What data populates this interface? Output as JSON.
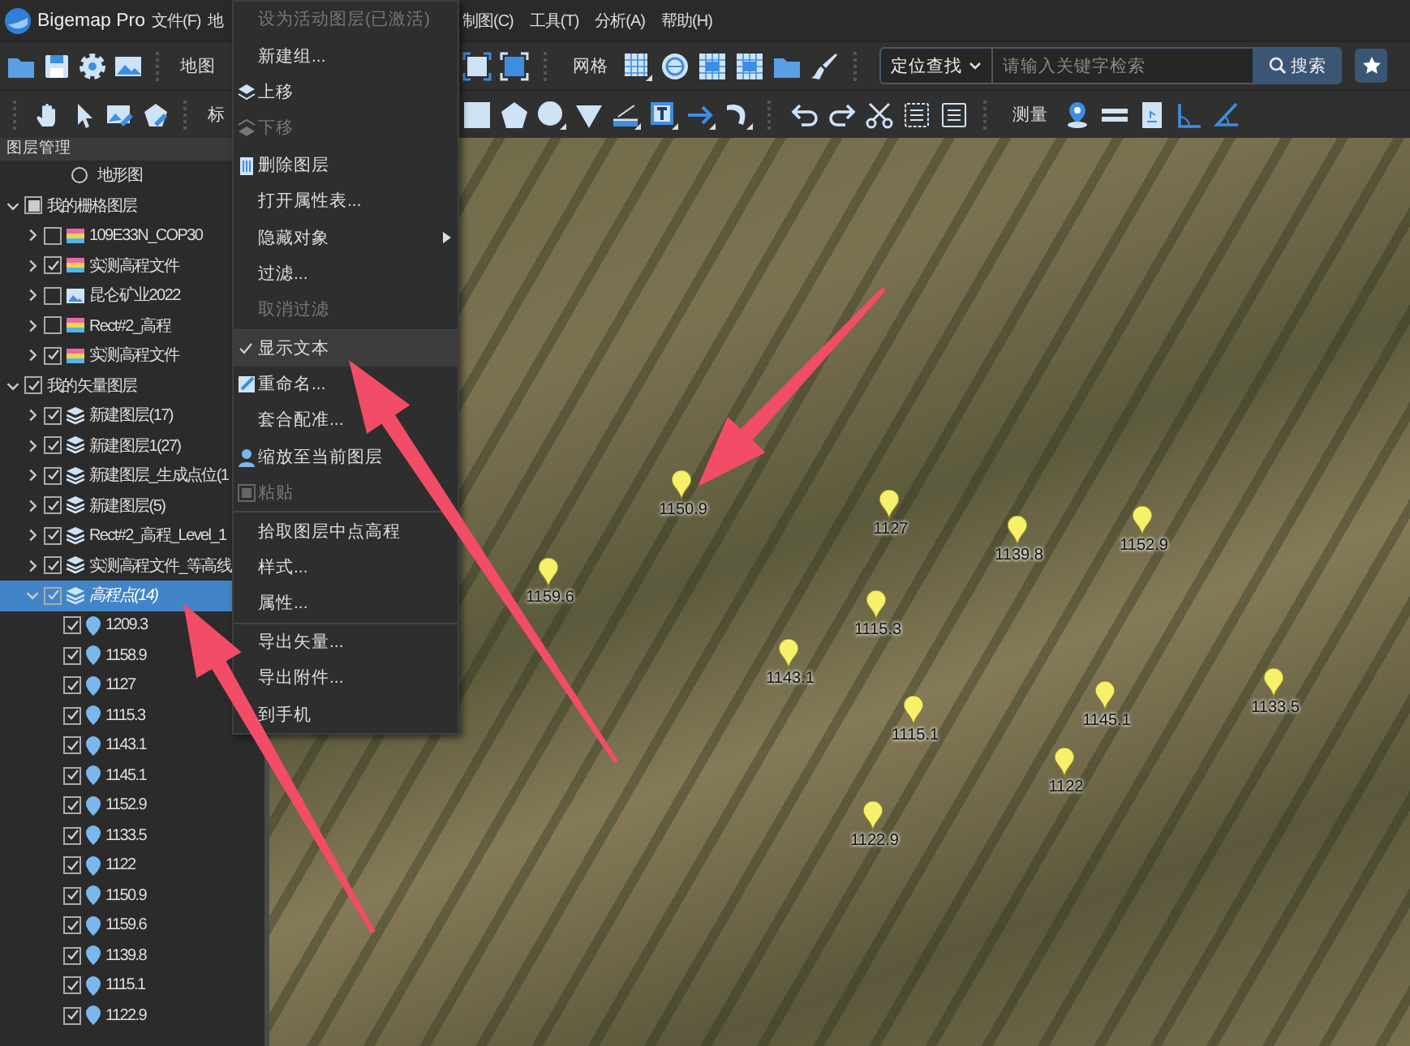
{
  "title_bar": {
    "app_name": "Bigemap Pro",
    "menus_left": [
      "文件(F)",
      "地"
    ],
    "menus_right": [
      "制图(C)",
      "工具(T)",
      "分析(A)",
      "帮助(H)"
    ]
  },
  "toolbars": [
    {
      "left_label": "地图",
      "right_label": "网格"
    },
    {
      "left_label": "标",
      "right_label": "测量"
    }
  ],
  "search": {
    "scope": "定位查找",
    "placeholder": "请输入关键字检索",
    "button": "搜索"
  },
  "layers": {
    "title": "图层管理",
    "tree": [
      {
        "label": "地形图",
        "kind": "radio",
        "checked": false,
        "selected": false
      },
      {
        "label": "我的栅格图层",
        "kind": "group",
        "expanded": true,
        "checked": false,
        "partial": true,
        "selected": false,
        "children": [
          {
            "label": "109E33N_COP30",
            "kind": "raster",
            "expanded": false,
            "checked": false,
            "selected": false
          },
          {
            "label": "实测高程文件",
            "kind": "raster",
            "expanded": false,
            "checked": true,
            "selected": false
          },
          {
            "label": "昆仑矿业2022",
            "kind": "image",
            "expanded": false,
            "checked": false,
            "selected": false
          },
          {
            "label": "Rect#2_高程",
            "kind": "raster",
            "expanded": false,
            "checked": false,
            "selected": false
          },
          {
            "label": "实测高程文件",
            "kind": "raster",
            "expanded": false,
            "checked": true,
            "selected": false
          }
        ]
      },
      {
        "label": "我的矢量图层",
        "kind": "group",
        "expanded": true,
        "checked": true,
        "partial": false,
        "selected": false,
        "children": [
          {
            "label": "新建图层(17)",
            "kind": "vector",
            "expanded": false,
            "checked": true,
            "selected": false
          },
          {
            "label": "新建图层1(27)",
            "kind": "vector",
            "expanded": false,
            "checked": true,
            "selected": false
          },
          {
            "label": "新建图层_生成点位(1",
            "kind": "vector",
            "expanded": false,
            "checked": true,
            "selected": false
          },
          {
            "label": "新建图层(5)",
            "kind": "vector",
            "expanded": false,
            "checked": true,
            "selected": false
          },
          {
            "label": "Rect#2_高程_Level_1",
            "kind": "vector",
            "expanded": false,
            "checked": true,
            "selected": false
          },
          {
            "label": "实测高程文件_等高线",
            "kind": "vector",
            "expanded": false,
            "checked": true,
            "selected": false
          },
          {
            "label": "高程点(14)",
            "kind": "vector",
            "expanded": true,
            "checked": true,
            "selected": true,
            "children": [
              {
                "label": "1209.3",
                "kind": "point",
                "checked": true,
                "selected": false
              },
              {
                "label": "1158.9",
                "kind": "point",
                "checked": true,
                "selected": false
              },
              {
                "label": "1127",
                "kind": "point",
                "checked": true,
                "selected": false
              },
              {
                "label": "1115.3",
                "kind": "point",
                "checked": true,
                "selected": false
              },
              {
                "label": "1143.1",
                "kind": "point",
                "checked": true,
                "selected": false
              },
              {
                "label": "1145.1",
                "kind": "point",
                "checked": true,
                "selected": false
              },
              {
                "label": "1152.9",
                "kind": "point",
                "checked": true,
                "selected": false
              },
              {
                "label": "1133.5",
                "kind": "point",
                "checked": true,
                "selected": false
              },
              {
                "label": "1122",
                "kind": "point",
                "checked": true,
                "selected": false
              },
              {
                "label": "1150.9",
                "kind": "point",
                "checked": true,
                "selected": false
              },
              {
                "label": "1159.6",
                "kind": "point",
                "checked": true,
                "selected": false
              },
              {
                "label": "1139.8",
                "kind": "point",
                "checked": true,
                "selected": false
              },
              {
                "label": "1115.1",
                "kind": "point",
                "checked": true,
                "selected": false
              },
              {
                "label": "1122.9",
                "kind": "point",
                "checked": true,
                "selected": false
              }
            ]
          }
        ]
      }
    ]
  },
  "context_menu": {
    "sections": [
      [
        {
          "label": "设为活动图层(已激活)",
          "kind": "plain",
          "disabled": true,
          "checked": false,
          "selected": false,
          "submenu": false
        },
        {
          "label": "新建组...",
          "kind": "plain",
          "disabled": false,
          "checked": false,
          "selected": false,
          "submenu": false
        },
        {
          "label": "上移",
          "kind": "move-up",
          "disabled": false,
          "checked": false,
          "selected": false,
          "submenu": false
        },
        {
          "label": "下移",
          "kind": "move-down",
          "disabled": true,
          "checked": false,
          "selected": false,
          "submenu": false
        },
        {
          "label": "删除图层",
          "kind": "delete",
          "disabled": false,
          "checked": false,
          "selected": false,
          "submenu": false
        },
        {
          "label": "打开属性表...",
          "kind": "plain",
          "disabled": false,
          "checked": false,
          "selected": false,
          "submenu": false
        },
        {
          "label": "隐藏对象",
          "kind": "plain",
          "disabled": false,
          "checked": false,
          "selected": false,
          "submenu": true
        },
        {
          "label": "过滤...",
          "kind": "plain",
          "disabled": false,
          "checked": false,
          "selected": false,
          "submenu": false
        },
        {
          "label": "取消过滤",
          "kind": "plain",
          "disabled": true,
          "checked": false,
          "selected": false,
          "submenu": false
        }
      ],
      [
        {
          "label": "显示文本",
          "kind": "plain",
          "disabled": false,
          "checked": true,
          "selected": true,
          "submenu": false
        },
        {
          "label": "重命名...",
          "kind": "rename",
          "disabled": false,
          "checked": false,
          "selected": false,
          "submenu": false
        },
        {
          "label": "套合配准...",
          "kind": "plain",
          "disabled": false,
          "checked": false,
          "selected": false,
          "submenu": false
        },
        {
          "label": "缩放至当前图层",
          "kind": "zoom",
          "disabled": false,
          "checked": false,
          "selected": false,
          "submenu": false
        },
        {
          "label": "粘贴",
          "kind": "paste",
          "disabled": true,
          "checked": false,
          "selected": false,
          "submenu": false
        }
      ],
      [
        {
          "label": "拾取图层中点高程",
          "kind": "plain",
          "disabled": false,
          "checked": false,
          "selected": false,
          "submenu": false
        },
        {
          "label": "样式...",
          "kind": "plain",
          "disabled": false,
          "checked": false,
          "selected": false,
          "submenu": false
        },
        {
          "label": "属性...",
          "kind": "plain",
          "disabled": false,
          "checked": false,
          "selected": false,
          "submenu": false
        }
      ],
      [
        {
          "label": "导出矢量...",
          "kind": "plain",
          "disabled": false,
          "checked": false,
          "selected": false,
          "submenu": false
        },
        {
          "label": "导出附件...",
          "kind": "plain",
          "disabled": false,
          "checked": false,
          "selected": false,
          "submenu": false
        },
        {
          "label": "到手机",
          "kind": "plain",
          "disabled": false,
          "checked": false,
          "selected": false,
          "submenu": false
        }
      ]
    ]
  },
  "map": {
    "points": [
      {
        "label": "1150.9"
      },
      {
        "label": "1127"
      },
      {
        "label": "1152.9"
      },
      {
        "label": "1139.8"
      },
      {
        "label": "1159.6"
      },
      {
        "label": "1115.3"
      },
      {
        "label": "1143.1"
      },
      {
        "label": "1133.5"
      },
      {
        "label": "1145.1"
      },
      {
        "label": "1115.1"
      },
      {
        "label": "1122"
      },
      {
        "label": "1122.9"
      }
    ]
  }
}
